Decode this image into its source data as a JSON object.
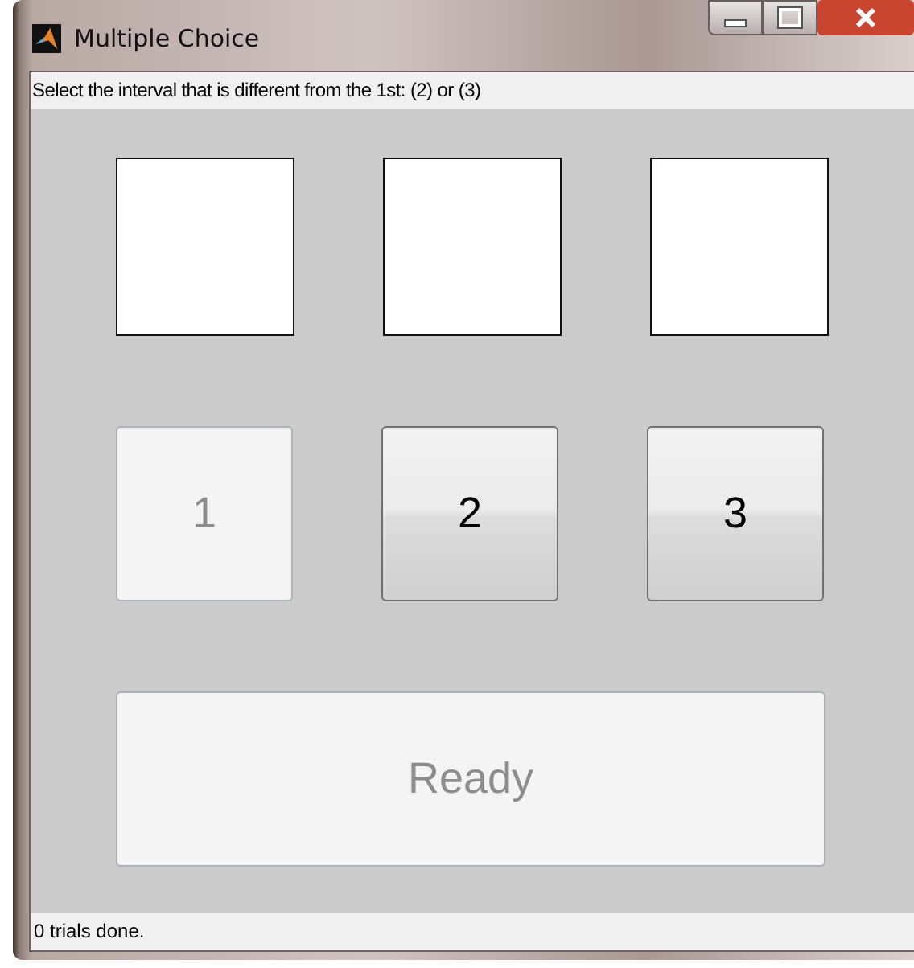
{
  "window": {
    "title": "Multiple Choice"
  },
  "instruction": "Select the interval that is different from the 1st: (2) or (3)",
  "stimulus_boxes": [
    {
      "kind": "blank"
    },
    {
      "kind": "blank"
    },
    {
      "kind": "blank"
    }
  ],
  "response_buttons": [
    {
      "label": "1",
      "disabled": true
    },
    {
      "label": "2",
      "disabled": false
    },
    {
      "label": "3",
      "disabled": false
    }
  ],
  "ready_button": {
    "label": "Ready",
    "disabled": true
  },
  "status_bar": "0 trials done."
}
